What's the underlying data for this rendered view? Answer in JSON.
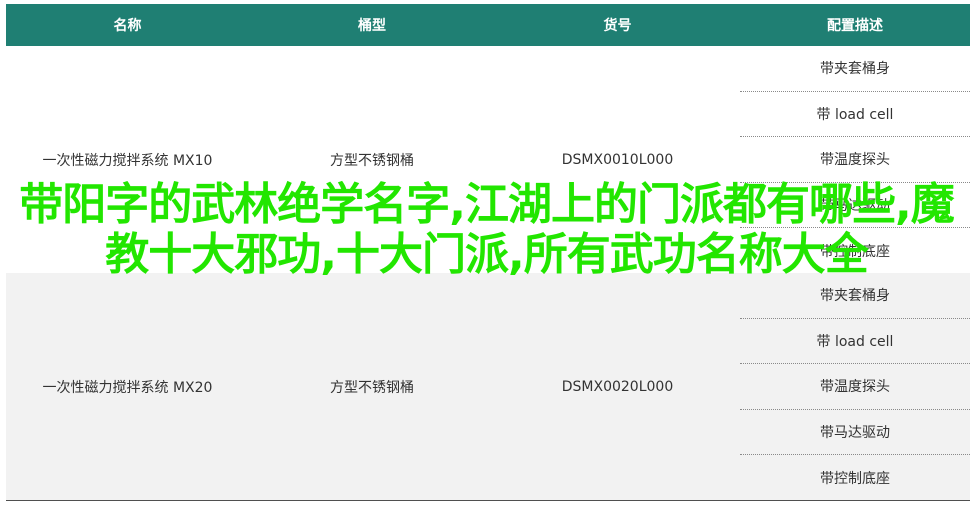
{
  "header": {
    "col_name": "名称",
    "col_bucket": "桶型",
    "col_sku": "货号",
    "col_config": "配置描述"
  },
  "rows": [
    {
      "name": "一次性磁力搅拌系统 MX10",
      "bucket": "方型不锈钢桶",
      "sku": "DSMX0010L000",
      "configs": [
        "带夹套桶身",
        "带 load cell",
        "带温度探头",
        "带马达驱动",
        "带控制底座"
      ]
    },
    {
      "name": "一次性磁力搅拌系统 MX20",
      "bucket": "方型不锈钢桶",
      "sku": "DSMX0020L000",
      "configs": [
        "带夹套桶身",
        "带 load cell",
        "带温度探头",
        "带马达驱动",
        "带控制底座"
      ]
    }
  ],
  "overlay": {
    "title": "带阳字的武林绝学名字,江湖上的门派都有哪些,魔教十大邪功,十大门派,所有武功名称大全"
  },
  "colors": {
    "header_bg": "#1f7f73",
    "overlay_text": "#22e600",
    "alt_row_bg": "#f2f2f2"
  }
}
